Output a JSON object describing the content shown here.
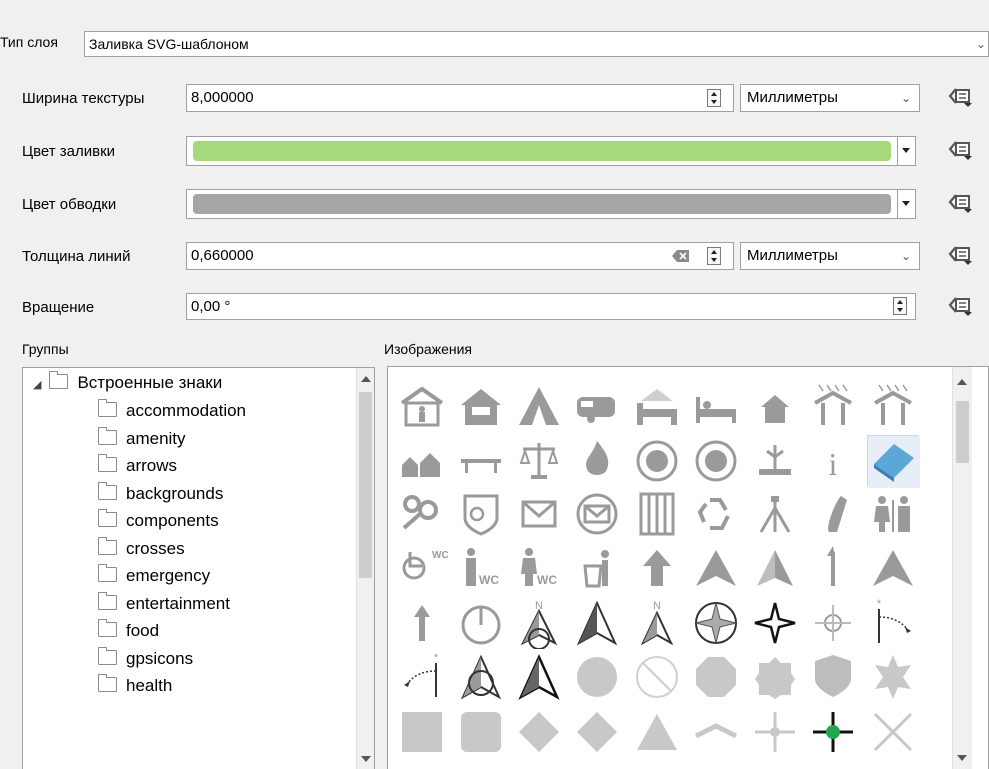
{
  "layer_type": {
    "label": "Тип слоя",
    "value": "Заливка SVG-шаблоном"
  },
  "texture_width": {
    "label": "Ширина текстуры",
    "value": "8,000000",
    "unit": "Миллиметры"
  },
  "fill_color": {
    "label": "Цвет заливки",
    "color": "#a6d97c"
  },
  "stroke_color": {
    "label": "Цвет обводки",
    "color": "#a6a6a6"
  },
  "line_width": {
    "label": "Толщина линий",
    "value": "0,660000",
    "unit": "Миллиметры"
  },
  "rotation": {
    "label": "Вращение",
    "value": "0,00 °"
  },
  "groups": {
    "label": "Группы",
    "root": "Встроенные знаки",
    "items": [
      "accommodation",
      "amenity",
      "arrows",
      "backgrounds",
      "components",
      "crosses",
      "emergency",
      "entertainment",
      "food",
      "gpsicons",
      "health"
    ]
  },
  "images": {
    "label": "Изображения",
    "icons": [
      [
        "hostel-icon",
        "bnb-icon",
        "camping-icon",
        "caravan-icon",
        "motel-icon",
        "bed-icon",
        "house-icon",
        "shelter-icon",
        "shelter-rain-icon"
      ],
      [
        "housing-icon",
        "bench-icon",
        "court-icon",
        "fire-icon",
        "fire-station-icon",
        "fire-station2-icon",
        "fountain-icon",
        "info-icon",
        "library-icon"
      ],
      [
        "toilets-icon",
        "police-icon",
        "post-box-icon",
        "post-office-icon",
        "prison-icon",
        "recycling-icon",
        "survey-point-icon",
        "telephone-icon",
        "toilets2-icon"
      ],
      [
        "wc-disabled-icon",
        "wc-men-icon",
        "wc-women-icon",
        "waste-basket-icon",
        "arrow-up-icon",
        "arrowhead-icon",
        "arrowhead2-icon",
        "arrow-thin-icon",
        "arrowhead3-icon"
      ],
      [
        "arrow-up2-icon",
        "north-circle-icon",
        "north-arrow-icon",
        "north-arrow2-icon",
        "north-arrow3-icon",
        "compass-rose-icon",
        "compass-star-icon",
        "compass-crosshair-icon",
        "north-flag-icon"
      ],
      [
        "north-flag2-icon",
        "north-arrow4-icon",
        "north-arrow5-icon",
        "circle-icon",
        "no-entry-icon",
        "octagon-icon",
        "badge-icon",
        "shield-icon",
        "star-badge-icon"
      ],
      [
        "square-icon",
        "rounded-square-icon",
        "diamond-icon",
        "diamond2-icon",
        "triangle-icon",
        "chevron-icon",
        "cross-icon",
        "cross-green-icon",
        "x-cross-icon"
      ]
    ]
  }
}
